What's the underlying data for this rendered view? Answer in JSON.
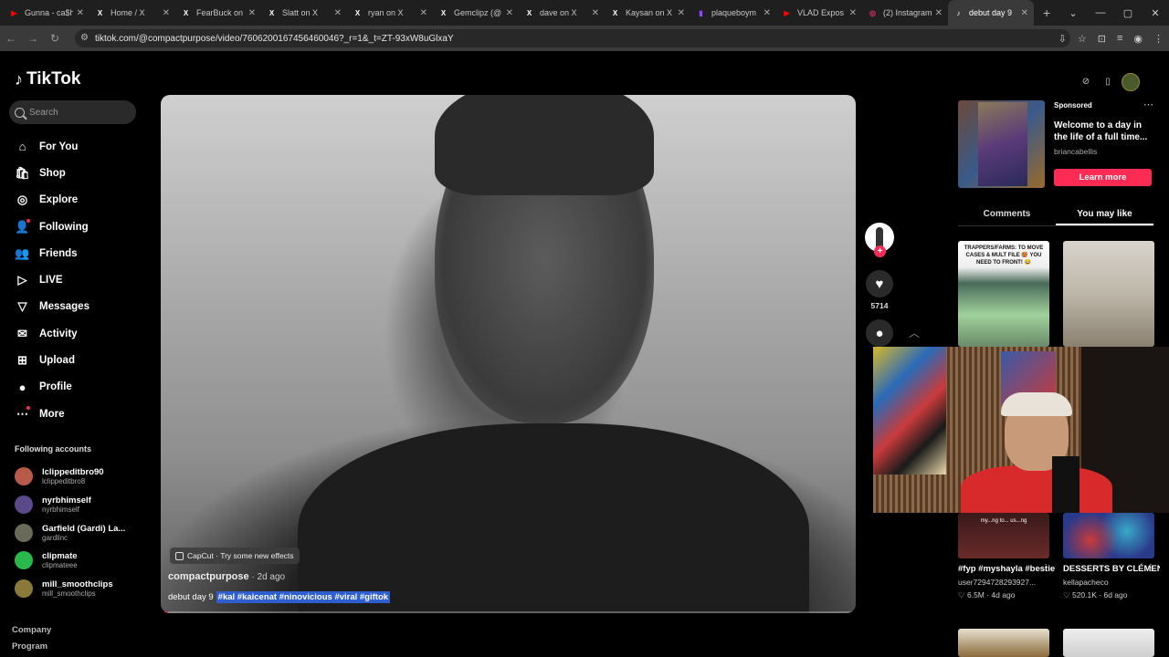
{
  "browser": {
    "tabs": [
      {
        "label": "Gunna - ca$h",
        "icon": "youtube-icon",
        "color": "#ff0000",
        "glyph": "▶"
      },
      {
        "label": "Home / X",
        "icon": "x-icon",
        "color": "#ffffff",
        "glyph": "X"
      },
      {
        "label": "FearBuck on",
        "icon": "x-icon",
        "color": "#ffffff",
        "glyph": "X"
      },
      {
        "label": "Slatt on X",
        "icon": "x-icon",
        "color": "#ffffff",
        "glyph": "X"
      },
      {
        "label": "ryan on X",
        "icon": "x-icon",
        "color": "#ffffff",
        "glyph": "X"
      },
      {
        "label": "Gemclipz (@",
        "icon": "x-icon",
        "color": "#ffffff",
        "glyph": "X"
      },
      {
        "label": "dave on X",
        "icon": "x-icon",
        "color": "#ffffff",
        "glyph": "X"
      },
      {
        "label": "Kaysan on X",
        "icon": "x-icon",
        "color": "#ffffff",
        "glyph": "X"
      },
      {
        "label": "plaqueboym",
        "icon": "twitch-icon",
        "color": "#9146ff",
        "glyph": "▮"
      },
      {
        "label": "VLAD Expos",
        "icon": "youtube-icon",
        "color": "#ff0000",
        "glyph": "▶"
      },
      {
        "label": "(2) Instagram",
        "icon": "instagram-icon",
        "color": "#e1306c",
        "glyph": "◎"
      },
      {
        "label": "debut day 9",
        "icon": "tiktok-icon",
        "color": "#ffffff",
        "glyph": "♪",
        "active": true
      }
    ],
    "new_tab": "+",
    "url": "tiktok.com/@compactpurpose/video/7606200167456460046?_r=1&_t=ZT-93xW8uGlxaY"
  },
  "brand": {
    "name": "TikTok"
  },
  "search": {
    "placeholder": "Search"
  },
  "nav": [
    {
      "label": "For You",
      "icon": "home-icon",
      "glyph": "⌂"
    },
    {
      "label": "Shop",
      "icon": "shop-icon",
      "glyph": "🛍"
    },
    {
      "label": "Explore",
      "icon": "compass-icon",
      "glyph": "◎"
    },
    {
      "label": "Following",
      "icon": "following-icon",
      "glyph": "👤",
      "dot": true
    },
    {
      "label": "Friends",
      "icon": "friends-icon",
      "glyph": "👥"
    },
    {
      "label": "LIVE",
      "icon": "live-icon",
      "glyph": "▷"
    },
    {
      "label": "Messages",
      "icon": "messages-icon",
      "glyph": "▽"
    },
    {
      "label": "Activity",
      "icon": "activity-icon",
      "glyph": "✉"
    },
    {
      "label": "Upload",
      "icon": "upload-icon",
      "glyph": "⊞"
    },
    {
      "label": "Profile",
      "icon": "profile-avatar-icon",
      "glyph": "●"
    },
    {
      "label": "More",
      "icon": "more-icon",
      "glyph": "⋯",
      "dot": true
    }
  ],
  "following_accounts": {
    "title": "Following accounts",
    "items": [
      {
        "name": "lclippeditbro90",
        "handle": "lclippeditbro8",
        "color": "#b85a4a"
      },
      {
        "name": "nyrbhimself",
        "handle": "nyrbhimself",
        "color": "#5a4a8a"
      },
      {
        "name": "Garfield (Gardi) La...",
        "handle": "gardlinc",
        "color": "#6a6a5a"
      },
      {
        "name": "clipmate",
        "handle": "clipmateee",
        "color": "#2ab84a"
      },
      {
        "name": "mill_smoothclips",
        "handle": "mill_smoothclips",
        "color": "#8a7a3a"
      }
    ]
  },
  "footer": {
    "company": "Company",
    "program": "Program"
  },
  "video": {
    "capcut_label": "CapCut · Try some new effects",
    "author": "compactpurpose",
    "age": " · 2d ago",
    "description": "debut day 9",
    "hashtags": "#kal #kaicenat #ninovicious #viral #giftok",
    "progress": 0.01
  },
  "actions": {
    "likes": "5714"
  },
  "ad": {
    "sponsored": "Sponsored",
    "title": "Welcome to a day in the life of a full time...",
    "handle": "briancabellis",
    "cta": "Learn more"
  },
  "right_tabs": [
    "Comments",
    "You may like"
  ],
  "thumbs": {
    "t1_text": "TRAPPERS/FARMS: TO MOVE CASES & MULT FILE 🥵 YOU NEED TO FRONT! 😂",
    "t3_text": "my...ng to... us...ng"
  },
  "cards": [
    {
      "title": "#fyp #myshayla #bestie...",
      "user": "user7294728293927...",
      "stats": "♡ 6.5M · 4d ago"
    },
    {
      "title": "DESSERTS BY CLÉMENT!! 🍫 ...",
      "user": "kellapacheco",
      "stats": "♡ 520.1K · 6d ago"
    }
  ]
}
